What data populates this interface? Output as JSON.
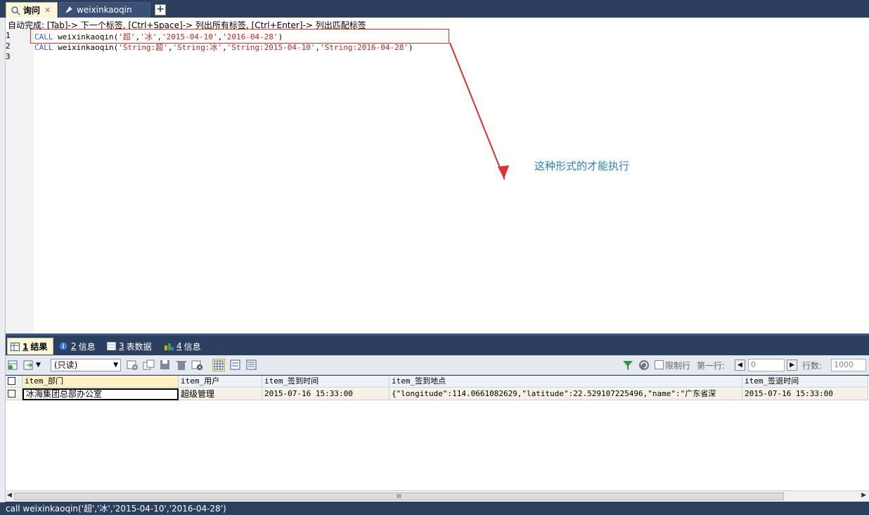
{
  "tabs": [
    {
      "label": "询问",
      "close": "✕"
    },
    {
      "label": "weixinkaoqin"
    }
  ],
  "add_tab": "+",
  "editor": {
    "hint": "自动完成: [Tab]-> 下一个标签, [Ctrl+Space]-> 列出所有标签, [Ctrl+Enter]-> 列出匹配标签",
    "line_numbers": [
      "1",
      "2",
      "3"
    ],
    "lines": [
      {
        "kw": "CALL",
        "fn": " weixinkaoqin(",
        "args": [
          "'超'",
          "'冰'",
          "'2015-04-10'",
          "'2016-04-28'"
        ],
        "end": ")"
      },
      {
        "kw": "CALL",
        "fn": " weixinkaoqin(",
        "args": [
          "'String:超'",
          "'String:冰'",
          "'String:2015-04-10'",
          "'String:2016-04-28'"
        ],
        "end": ")"
      }
    ],
    "annotation": "这种形式的才能执行"
  },
  "result_tabs": [
    {
      "num": "1",
      "label": "结果"
    },
    {
      "num": "2",
      "label": "信息"
    },
    {
      "num": "3",
      "label": "表数据"
    },
    {
      "num": "4",
      "label": "信息"
    }
  ],
  "toolbar": {
    "readonly_option": "(只读)",
    "limit_label": "限制行",
    "first_row_label": "第一行:",
    "first_row_value": "0",
    "rows_label": "行数:",
    "rows_value": "1000"
  },
  "grid": {
    "columns": [
      "item_部门",
      "item_用户",
      "item_签到时间",
      "item_签到地点",
      "item_签退时间"
    ],
    "rows": [
      [
        "冰海集团总部办公室",
        "超级管理",
        "2015-07-16 15:33:00",
        "{\"longitude\":114.0661082629,\"latitude\":22.529107225496,\"name\":\"广东省深",
        "2015-07-16 15:33:00"
      ]
    ]
  },
  "scroll_grip": "III",
  "status": "call weixinkaoqin('超','冰','2015-04-10','2016-04-28')",
  "colors": {
    "frame": "#2c3f5f",
    "keyword": "#3a60d0",
    "string": "#c0281e",
    "annotation": "#2a7fc0",
    "highlight_border": "#e03030"
  }
}
